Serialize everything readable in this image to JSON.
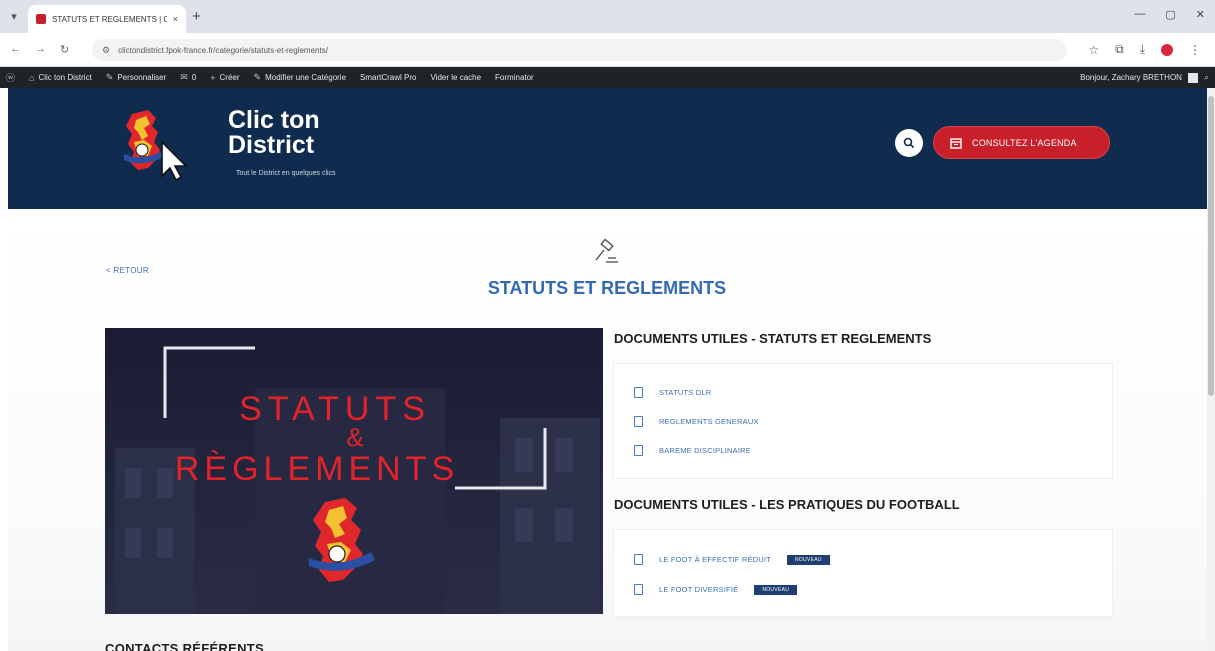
{
  "browser": {
    "tab_title": "STATUTS ET REGLEMENTS | Cli...",
    "tab_close": "×",
    "new_tab": "+",
    "window_controls": [
      "—",
      "▢",
      "✕"
    ],
    "url": "clictondistrict.fpok-france.fr/categorie/statuts-et-reglements/",
    "nav": [
      "←",
      "→",
      "↻"
    ]
  },
  "wp_admin": {
    "items": [
      "Clic ton District",
      "Personnaliser",
      "0",
      "Créer",
      "Modifier une Catégorie",
      "SmartCrawl Pro",
      "Vider le cache",
      "Forminator"
    ],
    "greeting": "Bonjour, Zachary BRETHON"
  },
  "header": {
    "brand_title": "Clic ton District",
    "tagline": "Tout le District en quelques clics",
    "agenda_label": "CONSULTEZ L'AGENDA",
    "brand_color": "#0f2c4f",
    "accent_color": "#c8202a"
  },
  "main": {
    "back_label": "< RETOUR",
    "page_title": "STATUTS ET REGLEMENTS",
    "hero_text": [
      "STATUTS",
      "&",
      "RÈGLEMENTS"
    ],
    "sections": [
      {
        "heading": "DOCUMENTS UTILES - STATUTS ET REGLEMENTS",
        "items": [
          {
            "label": "STATUTS DLR"
          },
          {
            "label": "REGLEMENTS GENERAUX"
          },
          {
            "label": "BAREME DISCIPLINAIRE"
          }
        ]
      },
      {
        "heading": "DOCUMENTS UTILES - LES PRATIQUES DU FOOTBALL",
        "items": [
          {
            "label": "LE FOOT À EFFECTIF RÉDUIT",
            "badge": "NOUVEAU"
          },
          {
            "label": "LE FOOT DIVERSIFIÉ",
            "badge": "NOUVEAU"
          }
        ]
      }
    ],
    "contacts_heading": "CONTACTS RÉFÉRENTS"
  }
}
